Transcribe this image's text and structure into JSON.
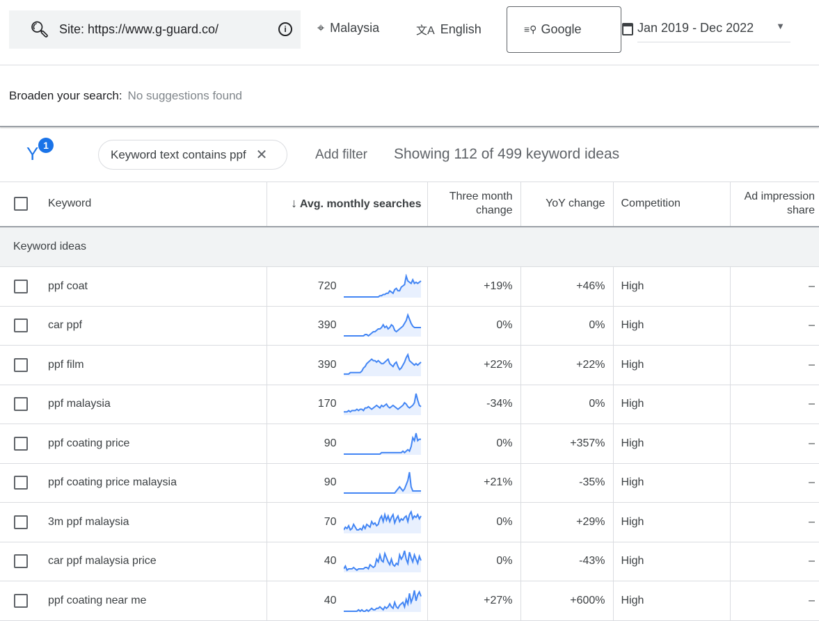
{
  "header": {
    "search_value": "Site: https://www.g-guard.co/",
    "location": "Malaysia",
    "language": "English",
    "network": "Google",
    "date_range": "Jan 2019 - Dec 2022"
  },
  "broaden": {
    "label": "Broaden your search:",
    "value": "No suggestions found"
  },
  "filters": {
    "count": "1",
    "chip": "Keyword text contains ppf",
    "add_filter": "Add filter",
    "showing": "Showing 112 of 499 keyword ideas"
  },
  "table": {
    "columns": [
      "Keyword",
      "Avg. monthly searches",
      "Three month change",
      "YoY change",
      "Competition",
      "Ad impression share"
    ],
    "group": "Keyword ideas",
    "accent": "#4285f4",
    "rows": [
      {
        "keyword": "ppf coat",
        "avg": "720",
        "three": "+19%",
        "yoy": "+46%",
        "comp": "High",
        "ais": "–",
        "trend": [
          0,
          0,
          0,
          0,
          0,
          0,
          0,
          0,
          0,
          0,
          0,
          0,
          0,
          0,
          0,
          0,
          0,
          0,
          0,
          0,
          0,
          0,
          1,
          1,
          2,
          2,
          3,
          3,
          5,
          4,
          3,
          6,
          7,
          5,
          5,
          8,
          9,
          10,
          17,
          13,
          12,
          11,
          14,
          11,
          12,
          11,
          12,
          13
        ]
      },
      {
        "keyword": "car ppf",
        "avg": "390",
        "three": "0%",
        "yoy": "0%",
        "comp": "High",
        "ais": "–",
        "trend": [
          0,
          0,
          0,
          0,
          0,
          0,
          0,
          0,
          0,
          0,
          0,
          0,
          0,
          1,
          1,
          0,
          1,
          2,
          3,
          3,
          4,
          5,
          5,
          6,
          8,
          6,
          7,
          5,
          6,
          8,
          7,
          4,
          3,
          4,
          5,
          6,
          7,
          9,
          11,
          15,
          12,
          9,
          7,
          6,
          6,
          6,
          6,
          6
        ]
      },
      {
        "keyword": "ppf film",
        "avg": "390",
        "three": "+22%",
        "yoy": "+22%",
        "comp": "High",
        "ais": "–",
        "trend": [
          1,
          1,
          1,
          1,
          2,
          2,
          2,
          2,
          2,
          2,
          2,
          3,
          5,
          6,
          8,
          9,
          10,
          11,
          10,
          10,
          9,
          10,
          9,
          8,
          8,
          9,
          10,
          11,
          8,
          7,
          6,
          8,
          9,
          6,
          4,
          5,
          7,
          9,
          12,
          14,
          10,
          9,
          8,
          7,
          8,
          7,
          8,
          9
        ]
      },
      {
        "keyword": "ppf malaysia",
        "avg": "170",
        "three": "-34%",
        "yoy": "0%",
        "comp": "High",
        "ais": "–",
        "trend": [
          2,
          2,
          2,
          3,
          2,
          3,
          3,
          3,
          4,
          3,
          4,
          4,
          3,
          5,
          5,
          6,
          5,
          4,
          5,
          6,
          7,
          6,
          5,
          7,
          6,
          7,
          8,
          6,
          5,
          6,
          7,
          6,
          5,
          4,
          5,
          6,
          7,
          9,
          8,
          6,
          5,
          6,
          7,
          9,
          16,
          11,
          7,
          6
        ]
      },
      {
        "keyword": "ppf coating price",
        "avg": "90",
        "three": "0%",
        "yoy": "+357%",
        "comp": "High",
        "ais": "–",
        "trend": [
          0,
          0,
          0,
          0,
          0,
          0,
          0,
          0,
          0,
          0,
          0,
          0,
          0,
          0,
          0,
          0,
          0,
          0,
          0,
          0,
          0,
          0,
          0,
          1,
          1,
          1,
          1,
          1,
          1,
          1,
          1,
          1,
          1,
          1,
          1,
          1,
          2,
          1,
          2,
          3,
          2,
          5,
          11,
          9,
          14,
          9,
          10,
          10
        ]
      },
      {
        "keyword": "ppf coating price malaysia",
        "avg": "90",
        "three": "+21%",
        "yoy": "-35%",
        "comp": "High",
        "ais": "–",
        "trend": [
          0,
          0,
          0,
          0,
          0,
          0,
          0,
          0,
          0,
          0,
          0,
          0,
          0,
          0,
          0,
          0,
          0,
          0,
          0,
          0,
          0,
          0,
          0,
          0,
          0,
          0,
          0,
          0,
          0,
          0,
          0,
          0,
          1,
          2,
          3,
          2,
          1,
          2,
          4,
          6,
          10,
          3,
          1,
          1,
          1,
          1,
          1,
          1
        ]
      },
      {
        "keyword": "3m ppf malaysia",
        "avg": "70",
        "three": "0%",
        "yoy": "+29%",
        "comp": "High",
        "ais": "–",
        "trend": [
          2,
          4,
          3,
          5,
          2,
          3,
          6,
          4,
          2,
          2,
          3,
          2,
          5,
          3,
          6,
          5,
          4,
          8,
          6,
          7,
          5,
          6,
          10,
          12,
          8,
          13,
          9,
          12,
          8,
          11,
          13,
          7,
          10,
          12,
          8,
          10,
          9,
          11,
          12,
          8,
          13,
          15,
          10,
          12,
          11,
          13,
          10,
          12
        ]
      },
      {
        "keyword": "car ppf malaysia price",
        "avg": "40",
        "three": "0%",
        "yoy": "-43%",
        "comp": "High",
        "ais": "–",
        "trend": [
          2,
          4,
          1,
          2,
          2,
          2,
          3,
          2,
          1,
          2,
          2,
          2,
          2,
          3,
          3,
          2,
          5,
          4,
          3,
          4,
          9,
          7,
          12,
          8,
          7,
          13,
          10,
          7,
          5,
          9,
          5,
          4,
          6,
          5,
          12,
          9,
          11,
          15,
          9,
          6,
          14,
          10,
          7,
          12,
          9,
          6,
          11,
          8
        ]
      },
      {
        "keyword": "ppf coating near me",
        "avg": "40",
        "three": "+27%",
        "yoy": "+600%",
        "comp": "High",
        "ais": "–",
        "trend": [
          0,
          0,
          0,
          0,
          0,
          0,
          0,
          0,
          0,
          1,
          0,
          1,
          0,
          0,
          1,
          0,
          1,
          2,
          1,
          1,
          2,
          2,
          3,
          2,
          1,
          3,
          2,
          3,
          5,
          3,
          2,
          6,
          3,
          2,
          4,
          5,
          6,
          3,
          8,
          5,
          12,
          6,
          9,
          14,
          7,
          11,
          13,
          10
        ]
      }
    ]
  }
}
